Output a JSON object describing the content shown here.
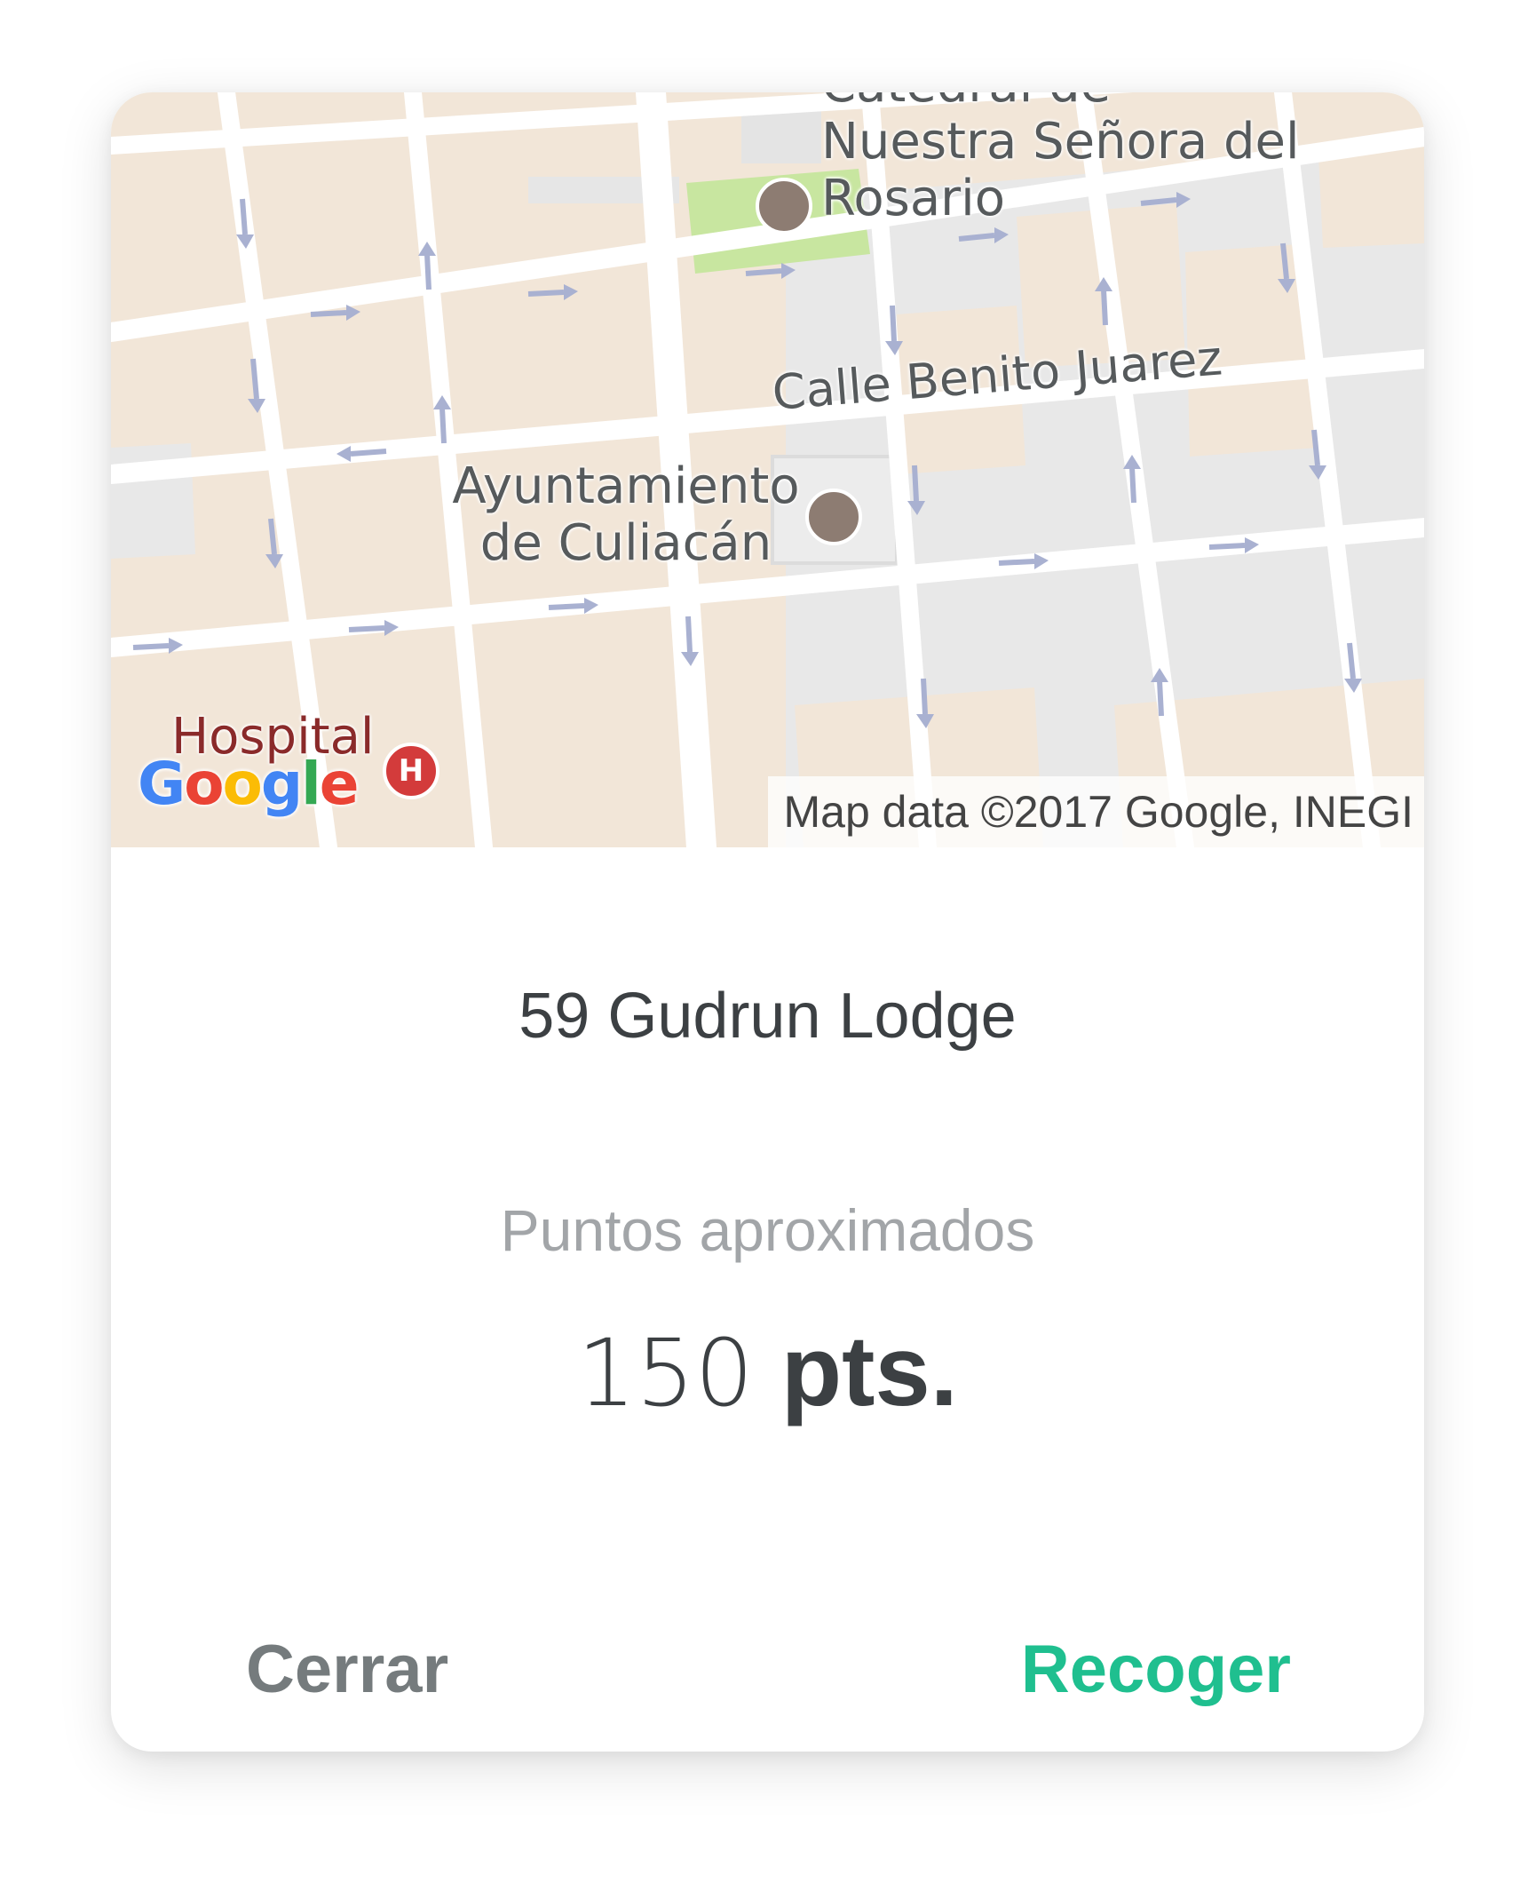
{
  "map": {
    "labels": {
      "cathedral": "Catedral de Nuestra Señora del Rosario",
      "street": "Calle Benito Juarez",
      "townhall": "Ayuntamiento de Culiacán",
      "hospital": "Hospital"
    },
    "hospital_badge": "H",
    "google_logo": "Google",
    "attribution": "Map data ©2017 Google, INEGI",
    "colors": {
      "block": "#f2e6d8",
      "block_gray": "#e8e8e8",
      "road": "#ffffff",
      "park": "#c8e6a0",
      "arrow": "#9fa8c8"
    }
  },
  "place": {
    "name": "59 Gudrun Lodge"
  },
  "points": {
    "caption": "Puntos aproximados",
    "value": "150",
    "unit": "pts."
  },
  "actions": {
    "close_label": "Cerrar",
    "collect_label": "Recoger"
  },
  "colors": {
    "accent": "#1fbf8f",
    "secondary_button": "#757b7d",
    "title_text": "#3c4043",
    "caption_text": "#a2a5a8"
  }
}
